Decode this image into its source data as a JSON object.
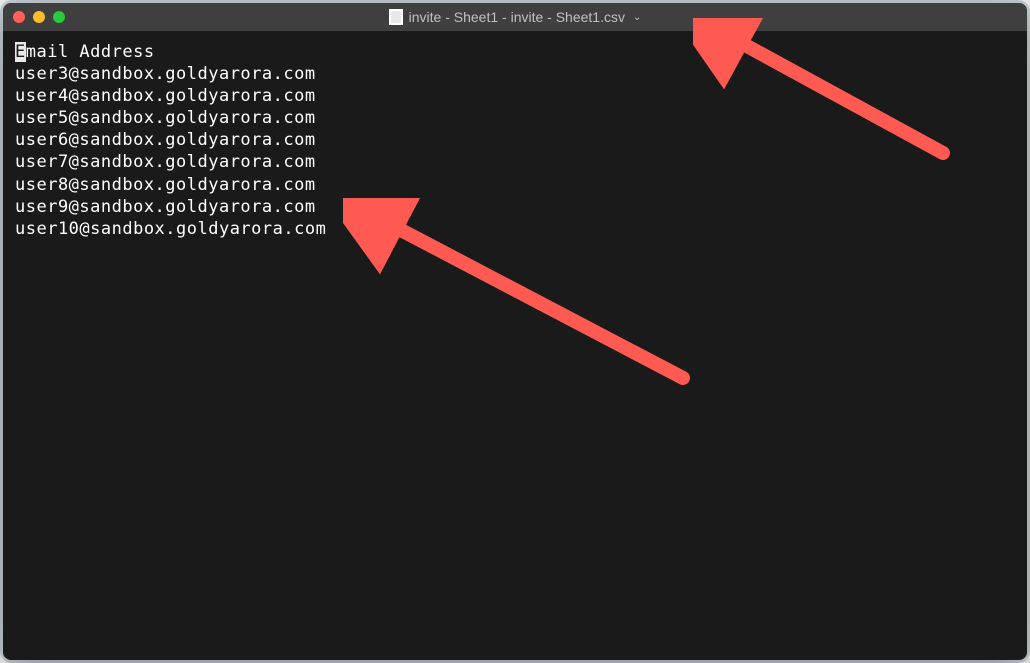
{
  "window": {
    "title": "invite - Sheet1 - invite - Sheet1.csv",
    "chevron": "⌄"
  },
  "traffic_lights": {
    "close": "close",
    "minimize": "minimize",
    "maximize": "maximize"
  },
  "file_content": {
    "header": "Email Address",
    "lines": [
      "user3@sandbox.goldyarora.com",
      "user4@sandbox.goldyarora.com",
      "user5@sandbox.goldyarora.com",
      "user6@sandbox.goldyarora.com",
      "user7@sandbox.goldyarora.com",
      "user8@sandbox.goldyarora.com",
      "user9@sandbox.goldyarora.com",
      "user10@sandbox.goldyarora.com"
    ]
  },
  "arrows": {
    "color": "#ff5a52"
  }
}
